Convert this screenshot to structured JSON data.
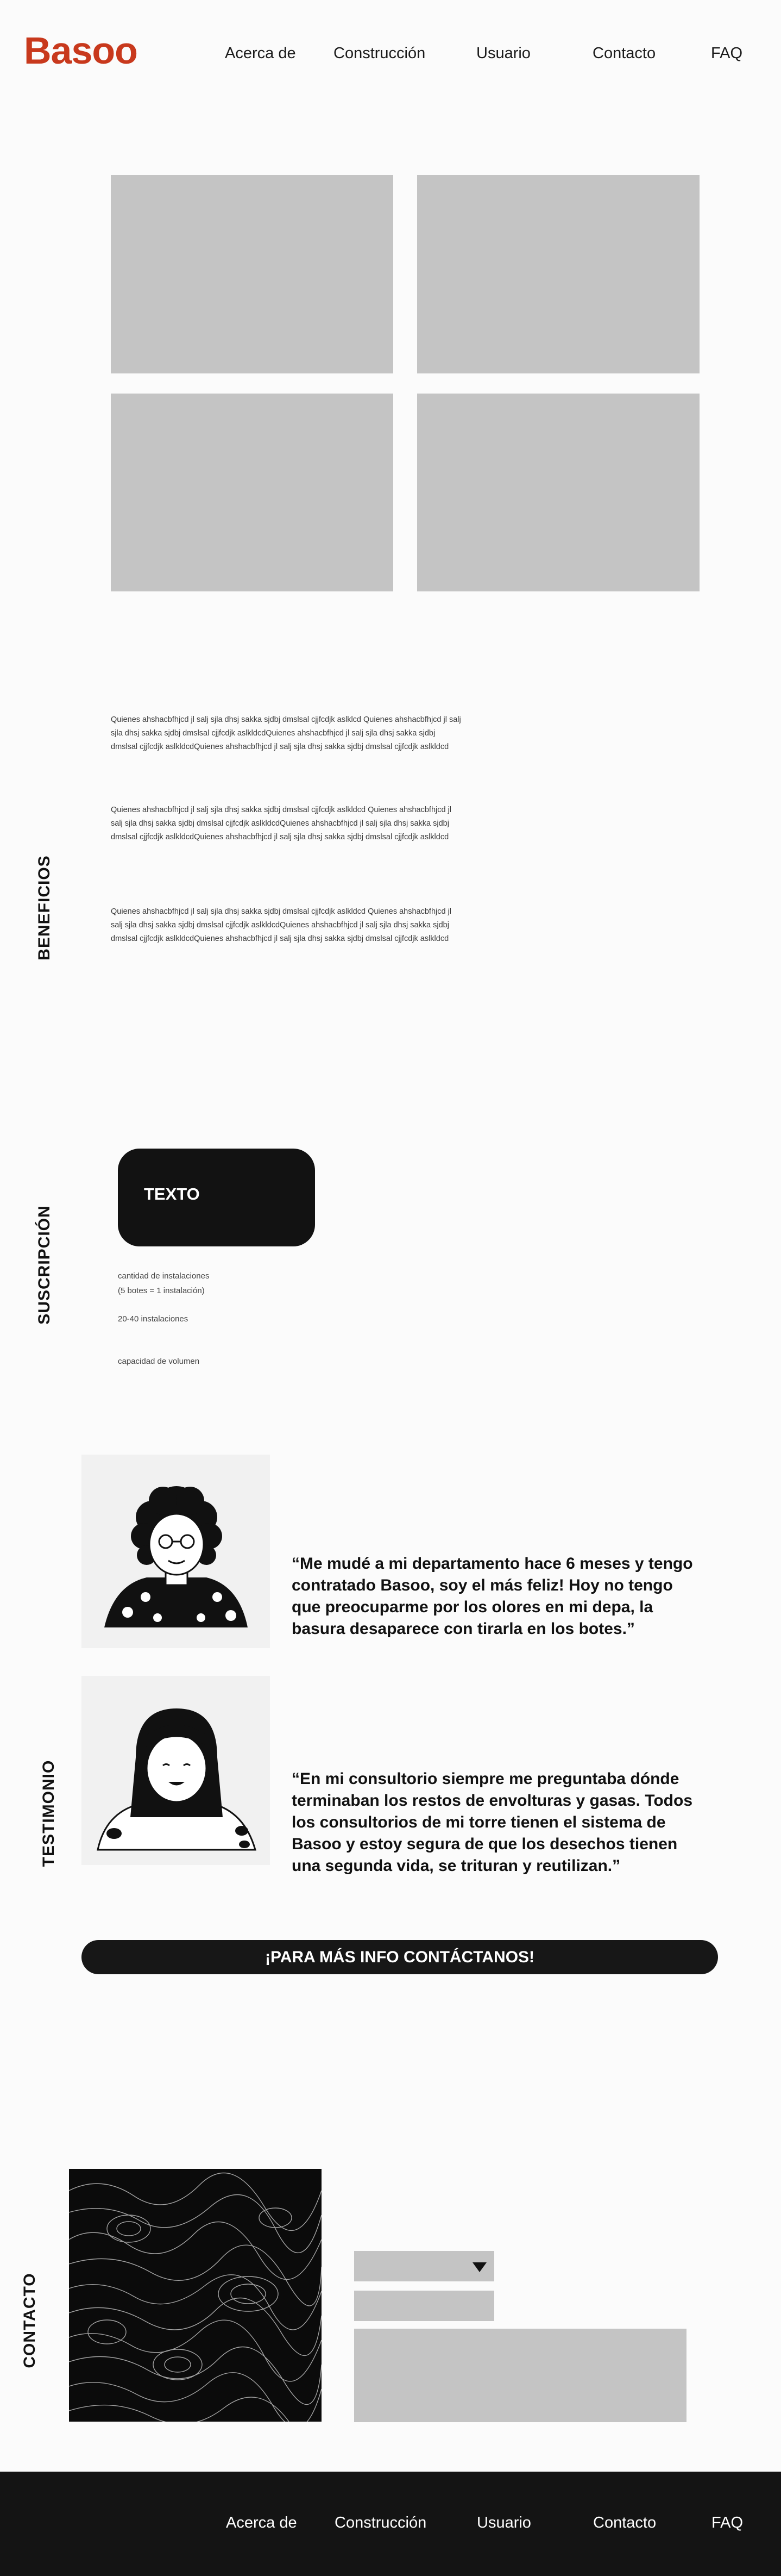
{
  "brand": {
    "logo": "Basoo",
    "color": "#c8391d"
  },
  "nav": {
    "items": [
      "Acerca de",
      "Construcción",
      "Usuario",
      "Contacto",
      "FAQ"
    ]
  },
  "sections": {
    "beneficios": "BENEFICIOS",
    "suscripcion": "SUSCRIPCIÓN",
    "testimonio": "TESTIMONIO",
    "contacto": "CONTACTO"
  },
  "beneficios": {
    "paragraphs": [
      "Quienes ahshacbfhjcd jl salj sjla dhsj sakka sjdbj dmslsal cjjfcdjk  aslklcd Quienes ahshacbfhjcd jl salj sjla dhsj sakka sjdbj dmslsal cjjfcdjk  aslkldcdQuienes ahshacbfhjcd jl salj sjla dhsj sakka sjdbj dmslsal cjjfcdjk  aslkldcdQuienes ahshacbfhjcd jl salj sjla dhsj sakka sjdbj dmslsal cjjfcdjk  aslkldcd",
      "Quienes ahshacbfhjcd jl salj sjla dhsj sakka sjdbj dmslsal cjjfcdjk  aslkldcd Quienes ahshacbfhjcd jl salj sjla dhsj sakka sjdbj dmslsal cjjfcdjk  aslkldcdQuienes ahshacbfhjcd jl salj sjla dhsj sakka sjdbj dmslsal cjjfcdjk  aslkldcdQuienes ahshacbfhjcd jl salj sjla dhsj sakka sjdbj dmslsal cjjfcdjk  aslkldcd",
      "Quienes ahshacbfhjcd jl salj sjla dhsj sakka sjdbj dmslsal cjjfcdjk  aslkldcd Quienes ahshacbfhjcd jl salj sjla dhsj sakka sjdbj dmslsal cjjfcdjk  aslkldcdQuienes ahshacbfhjcd jl salj sjla dhsj sakka sjdbj dmslsal cjjfcdjk  aslkldcdQuienes ahshacbfhjcd jl salj sjla dhsj sakka sjdbj dmslsal cjjfcdjk  aslkldcd"
    ]
  },
  "suscripcion": {
    "button": "TEXTO",
    "install_line1": "cantidad de instalaciones",
    "install_line2": "(5 botes = 1 instalación)",
    "range": "20-40 instalaciones",
    "capacity": "capacidad de  volumen"
  },
  "testimonios": [
    {
      "quote": "“Me mudé a mi departamento hace 6 meses y tengo contratado Basoo, soy el más feliz! Hoy no tengo que preocuparme por los olores en mi depa, la basura desaparece con tirarla en los botes.”"
    },
    {
      "quote": "“En mi consultorio siempre me preguntaba dónde terminaban los restos de envolturas y gasas. Todos los consultorios de mi torre tienen el sistema de Basoo y estoy segura de que los desechos tienen una segunda vida, se trituran y reutilizan.”"
    }
  ],
  "cta": "¡PARA MÁS INFO CONTÁCTANOS!",
  "icons": {
    "dropdown": "caret-down-icon",
    "avatar1": "curly-hair-woman-avatar",
    "avatar2": "bangs-woman-avatar",
    "map": "topographic-map"
  }
}
